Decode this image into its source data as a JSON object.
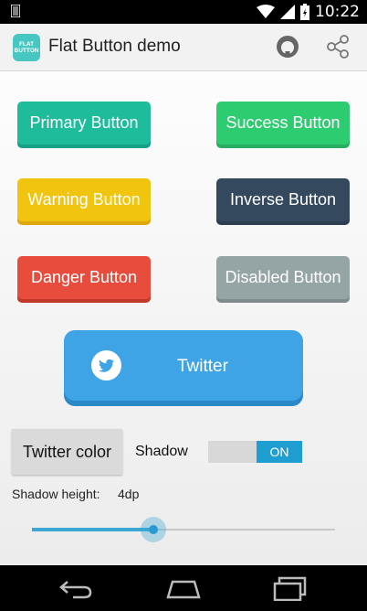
{
  "status_bar": {
    "time": "10:22"
  },
  "action_bar": {
    "app_icon_line1": "FLAT",
    "app_icon_line2": "BUTTON",
    "title": "Flat Button demo",
    "icons": [
      "github-icon",
      "share-icon"
    ]
  },
  "buttons": {
    "primary": "Primary Button",
    "success": "Success Button",
    "warning": "Warning Button",
    "inverse": "Inverse Button",
    "danger": "Danger Button",
    "disabled": "Disabled Button",
    "twitter": "Twitter"
  },
  "controls": {
    "color_button": "Twitter color",
    "shadow_label": "Shadow",
    "shadow_toggle_state": "ON",
    "shadow_height_label": "Shadow height:",
    "shadow_height_value": "4dp",
    "shadow_height_fraction": 0.4
  },
  "colors": {
    "primary": "#1fbc9c",
    "success": "#2ecc71",
    "warning": "#f1c40f",
    "inverse": "#34495e",
    "danger": "#e74c3c",
    "disabled": "#95a5a6",
    "twitter": "#3ea4e6",
    "accent": "#1e9ed1"
  }
}
